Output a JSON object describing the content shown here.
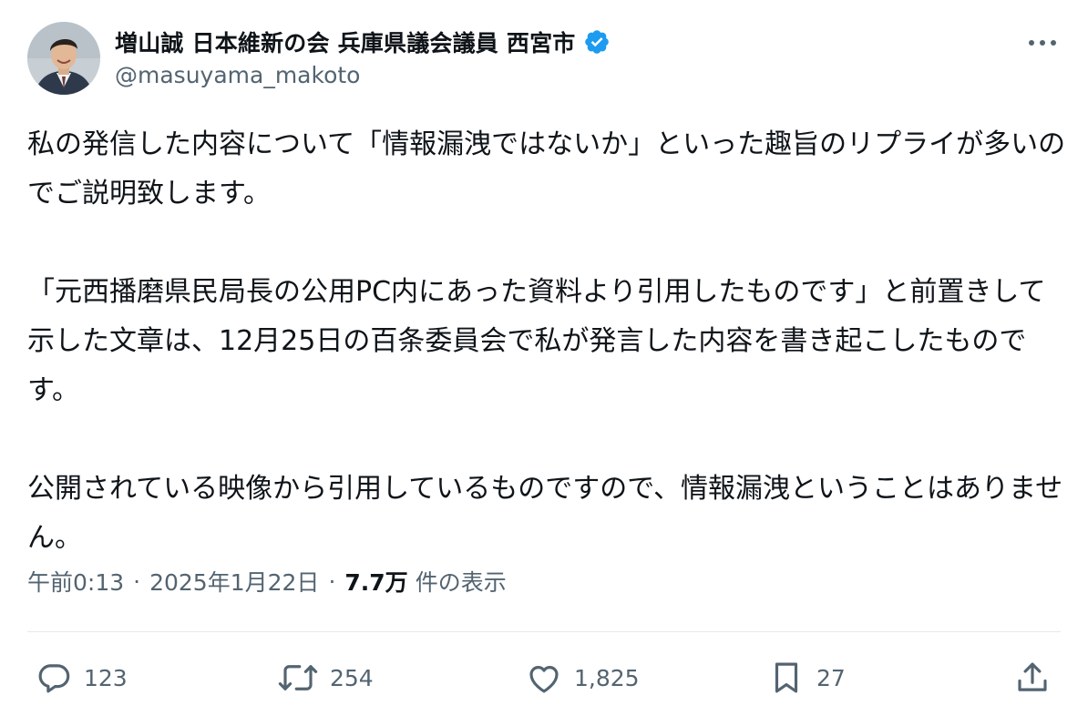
{
  "author": {
    "display_name": "増山誠 日本維新の会 兵庫県議会議員 西宮市",
    "handle": "@masuyama_makoto",
    "verified": true
  },
  "post": {
    "paragraphs": [
      "私の発信した内容について「情報漏洩ではないか」といった趣旨のリプライが多いのでご説明致します。",
      "「元西播磨県民局長の公用PC内にあった資料より引用したものです」と前置きして示した文章は、12月25日の百条委員会で私が発言した内容を書き起こしたものです。",
      "公開されている映像から引用しているものですので、情報漏洩ということはありません。"
    ]
  },
  "meta": {
    "time": "午前0:13",
    "date": "2025年1月22日",
    "views_count": "7.7万",
    "views_label": "件の表示"
  },
  "actions": {
    "replies": "123",
    "reposts": "254",
    "likes": "1,825",
    "bookmarks": "27"
  },
  "icons": {
    "verified": "verified-badge-icon",
    "more": "more-options-icon",
    "reply": "reply-icon",
    "repost": "repost-icon",
    "like": "heart-icon",
    "bookmark": "bookmark-icon",
    "share": "share-icon"
  },
  "colors": {
    "text_primary": "#0f1419",
    "text_secondary": "#536471",
    "verified_blue": "#1d9bf0",
    "divider": "#e6e9ec"
  }
}
